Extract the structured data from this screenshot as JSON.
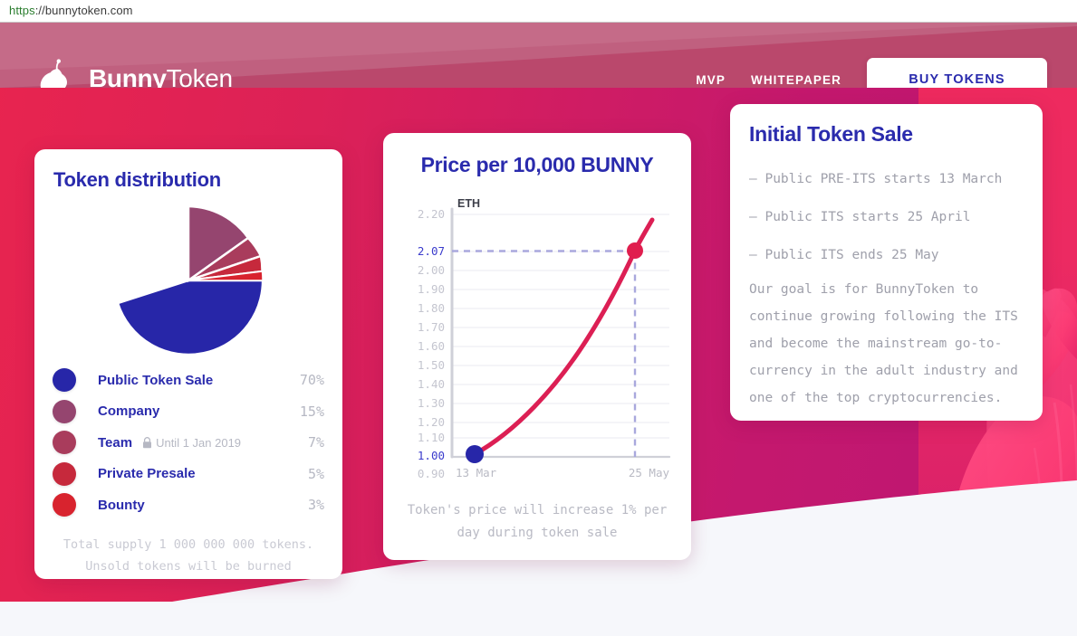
{
  "browser": {
    "url_scheme": "https",
    "url_rest": "://bunnytoken.com",
    "url_full": "https://bunnytoken.com"
  },
  "header": {
    "brand_bold": "Bunny",
    "brand_light": "Token",
    "logo_icon": "bunny-icon",
    "nav": [
      {
        "label": "MVP"
      },
      {
        "label": "WHITEPAPER"
      }
    ],
    "buy_label": "BUY TOKENS"
  },
  "distribution": {
    "title": "Token distribution",
    "footer_line1": "Total supply 1 000 000 000 tokens.",
    "footer_line2": "Unsold tokens will be burned",
    "lock_icon": "lock-icon",
    "legend": [
      {
        "label": "Public Token Sale",
        "note": "",
        "pct": "70%",
        "color": "#2726a8"
      },
      {
        "label": "Company",
        "note": "",
        "pct": "15%",
        "color": "#95456f"
      },
      {
        "label": "Team",
        "note": "Until 1 Jan 2019",
        "pct": "7%",
        "color": "#a93c5c"
      },
      {
        "label": "Private Presale",
        "note": "",
        "pct": "5%",
        "color": "#c6293c"
      },
      {
        "label": "Bounty",
        "note": "",
        "pct": "3%",
        "color": "#d8232e"
      }
    ]
  },
  "price_chart": {
    "title": "Price per 10,000 BUNNY",
    "footer_line1": "Token's price will increase 1% per",
    "footer_line2": "day during token sale"
  },
  "sale": {
    "title": "Initial Token Sale",
    "items": [
      "– Public PRE-ITS starts 13 March",
      "– Public ITS starts 25 April",
      "– Public ITS ends 25 May"
    ],
    "paragraph": "Our goal is for BunnyToken to continue growing following the ITS and become the mainstream go-to-currency in the adult industry and one of the top cryptocurrencies."
  },
  "chart_data": {
    "type": "line",
    "title": "Price per 10,000 BUNNY",
    "xlabel": "",
    "ylabel": "ETH",
    "y_axis_unit": "ETH",
    "ylim": [
      0.9,
      2.2
    ],
    "grid": true,
    "legend_position": "none",
    "y_ticks": [
      "2.20",
      "2.07",
      "2.00",
      "1.90",
      "1.80",
      "1.70",
      "1.60",
      "1.50",
      "1.40",
      "1.30",
      "1.20",
      "1.10",
      "1.00",
      "0.90"
    ],
    "y_ticks_highlighted": [
      "2.07",
      "1.00"
    ],
    "x_ticks": [
      "13 Mar",
      "25 May"
    ],
    "categories": [
      "13 Mar",
      "25 May"
    ],
    "series": [
      {
        "name": "Price per 10,000 BUNNY (ETH)",
        "color": "#dc1f54",
        "x": [
          0,
          0.1,
          0.2,
          0.3,
          0.4,
          0.5,
          0.6,
          0.7,
          0.8,
          0.9,
          1.0
        ],
        "values": [
          1.0,
          1.07,
          1.15,
          1.24,
          1.33,
          1.43,
          1.53,
          1.65,
          1.78,
          1.92,
          2.07
        ]
      }
    ],
    "markers": [
      {
        "label": "start",
        "x": "13 Mar",
        "y": 1.0,
        "color": "#2726a8"
      },
      {
        "label": "end",
        "x": "25 May",
        "y": 2.07,
        "color": "#e01e4e"
      }
    ],
    "guides": [
      {
        "type": "horizontal",
        "value": 2.07,
        "style": "dashed",
        "color": "#a9a8dd"
      },
      {
        "type": "vertical",
        "value": "25 May",
        "style": "dashed",
        "color": "#a9a8dd"
      }
    ],
    "annotation": "Token's price will increase 1% per day during token sale"
  },
  "colors": {
    "brand_blue": "#2a2bad",
    "crimson": "#dc1f54",
    "magenta": "#bc1673",
    "muted_text": "#b6b8c3"
  }
}
